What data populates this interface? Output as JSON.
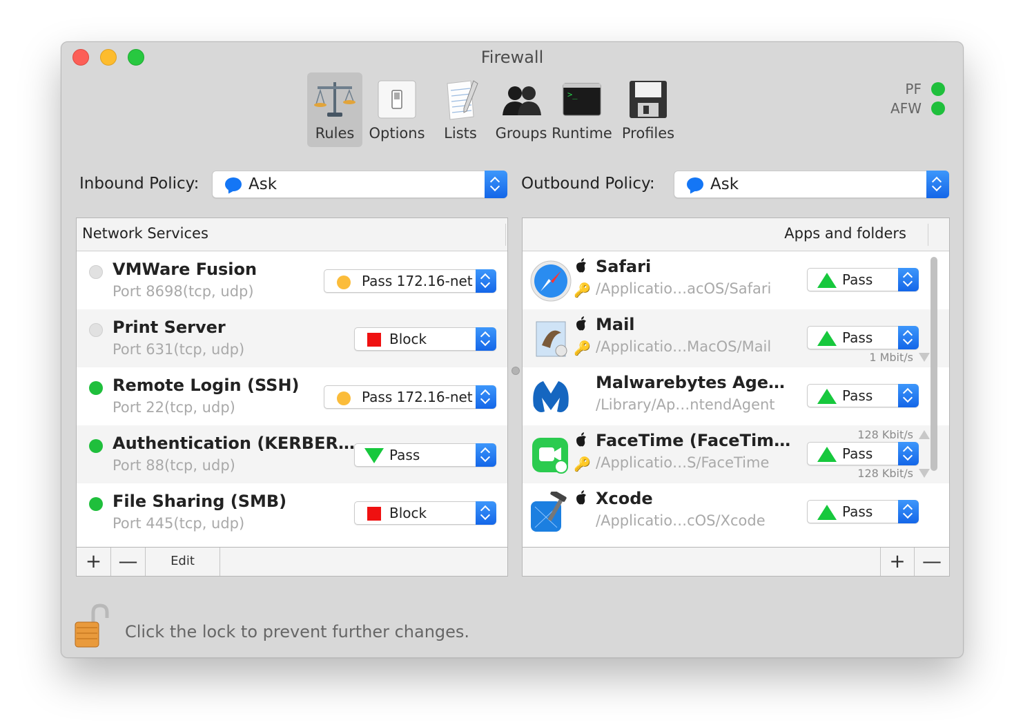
{
  "window": {
    "title": "Firewall"
  },
  "toolbar": {
    "items": [
      {
        "label": "Rules",
        "icon": "scales-icon"
      },
      {
        "label": "Options",
        "icon": "switch-icon"
      },
      {
        "label": "Lists",
        "icon": "notepad-icon"
      },
      {
        "label": "Groups",
        "icon": "users-icon"
      },
      {
        "label": "Runtime",
        "icon": "terminal-icon"
      },
      {
        "label": "Profiles",
        "icon": "floppy-icon"
      }
    ]
  },
  "status": {
    "pf_label": "PF",
    "afw_label": "AFW",
    "pf_color": "#1fbf3c",
    "afw_color": "#1fbf3c"
  },
  "policies": {
    "inbound_label": "Inbound Policy:",
    "inbound_value": "Ask",
    "outbound_label": "Outbound Policy:",
    "outbound_value": "Ask"
  },
  "network_services": {
    "header": "Network Services",
    "rows": [
      {
        "name": "VMWare Fusion",
        "port": "Port 8698(tcp, udp)",
        "active": false,
        "action": "Pass 172.16-net",
        "action_icon": "orange-circle"
      },
      {
        "name": "Print Server",
        "port": "Port 631(tcp, udp)",
        "active": false,
        "action": "Block",
        "action_icon": "red-square"
      },
      {
        "name": "Remote Login (SSH)",
        "port": "Port 22(tcp, udp)",
        "active": true,
        "action": "Pass 172.16-net",
        "action_icon": "orange-circle"
      },
      {
        "name": "Authentication (KERBER…",
        "port": "Port 88(tcp, udp)",
        "active": true,
        "action": "Pass",
        "action_icon": "green-down-triangle"
      },
      {
        "name": "File Sharing (SMB)",
        "port": "Port 445(tcp, udp)",
        "active": true,
        "action": "Block",
        "action_icon": "red-square"
      }
    ],
    "footer": {
      "add": "+",
      "remove": "—",
      "edit": "Edit"
    }
  },
  "apps": {
    "header": "Apps and folders",
    "rows": [
      {
        "name": "Safari",
        "path": "/Applicatio…acOS/Safari",
        "action": "Pass",
        "icon": "safari-icon",
        "apple": true,
        "key": true
      },
      {
        "name": "Mail",
        "path": "/Applicatio…MacOS/Mail",
        "action": "Pass",
        "icon": "mail-icon",
        "apple": true,
        "key": true,
        "rate_down": "1 Mbit/s"
      },
      {
        "name": "Malwarebytes Age…",
        "path": "/Library/Ap…ntendAgent",
        "action": "Pass",
        "icon": "malwarebytes-icon",
        "apple": false,
        "key": false
      },
      {
        "name": "FaceTime (FaceTim…",
        "path": "/Applicatio…S/FaceTime",
        "action": "Pass",
        "icon": "facetime-icon",
        "apple": true,
        "key": true,
        "rate_up": "128 Kbit/s",
        "rate_down": "128 Kbit/s"
      },
      {
        "name": "Xcode",
        "path": "/Applicatio…cOS/Xcode",
        "action": "Pass",
        "icon": "xcode-icon",
        "apple": true,
        "key": false
      }
    ],
    "footer": {
      "add": "+",
      "remove": "—"
    }
  },
  "lock": {
    "text": "Click the lock to prevent further changes.",
    "icon": "unlocked-padlock-icon"
  }
}
